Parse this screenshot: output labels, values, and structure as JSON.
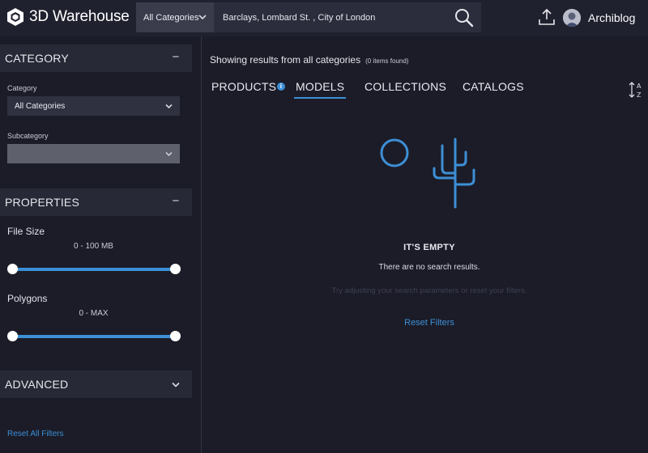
{
  "header": {
    "brand": "3D Warehouse",
    "category_select": "All Categories",
    "search_value": "Barclays, Lombard St. , City of London",
    "username": "Archiblog"
  },
  "sidebar": {
    "category_section": {
      "title": "CATEGORY",
      "toggle": "−",
      "category_label": "Category",
      "category_value": "All Categories",
      "subcategory_label": "Subcategory",
      "subcategory_value": ""
    },
    "properties_section": {
      "title": "PROPERTIES",
      "toggle": "−",
      "file_size_label": "File Size",
      "file_size_range": "0 - 100 MB",
      "polygons_label": "Polygons",
      "polygons_range": "0 - MAX"
    },
    "advanced_section": {
      "title": "ADVANCED"
    },
    "reset_all": "Reset All Filters"
  },
  "main": {
    "status": "Showing results from all categories",
    "count": "(0 items found)",
    "tabs": [
      {
        "label": "PRODUCTS"
      },
      {
        "label": "MODELS"
      },
      {
        "label": "COLLECTIONS"
      },
      {
        "label": "CATALOGS"
      }
    ],
    "active_tab": "MODELS",
    "empty_title": "IT'S EMPTY",
    "empty_sub": "There are no search results.",
    "empty_hint": "Try adjusting your search parameters or reset your filters.",
    "reset_filters": "Reset Filters"
  },
  "colors": {
    "accent": "#3d8fd6",
    "header_bg": "#20212e",
    "body_bg": "#1b1c28"
  },
  "icons": {
    "logo": "cube-logo-icon",
    "search": "search-icon",
    "upload": "upload-icon",
    "info": "info-icon",
    "sort": "sort-az-icon"
  }
}
